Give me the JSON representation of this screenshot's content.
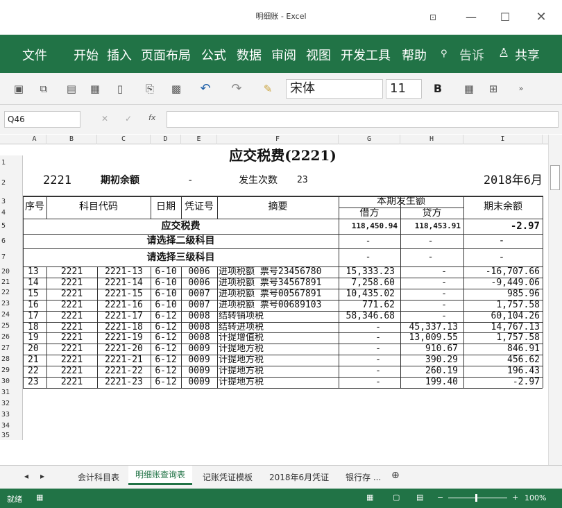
{
  "window": {
    "title": "明细账 - Excel",
    "ribbon_display_icon": "ribbon-display-icon",
    "minimize": "minimize-icon",
    "maximize": "maximize-icon",
    "close": "close-icon"
  },
  "ribbon": {
    "tabs": [
      "文件",
      "开始",
      "插入",
      "页面布局",
      "公式",
      "数据",
      "审阅",
      "视图",
      "开发工具",
      "帮助"
    ],
    "tell_me": "告诉",
    "share": "共享",
    "accent": "#217346"
  },
  "toolbar": {
    "font_name": "宋体",
    "font_size": "11",
    "bold": "B"
  },
  "formula_bar": {
    "name_box": "Q46",
    "fx": "fx",
    "value": ""
  },
  "columns": [
    "A",
    "B",
    "C",
    "D",
    "E",
    "F",
    "G",
    "H",
    "I"
  ],
  "sheet": {
    "title": "应交税费(2221)",
    "account_code": "2221",
    "opening_label": "期初余额",
    "opening_value": "-",
    "count_label": "发生次数",
    "count_value": "23",
    "period": "2018年6月",
    "headers": {
      "seq": "序号",
      "code": "科目代码",
      "date": "日期",
      "voucher": "凭证号",
      "summary": "摘要",
      "period_amount": "本期发生额",
      "debit": "借方",
      "credit": "贷方",
      "balance": "期末余额"
    },
    "total_row": {
      "label": "应交税费",
      "debit": "118,450.94",
      "credit": "118,453.91",
      "balance": "-2.97"
    },
    "level2_row": {
      "label": "请选择二级科目",
      "debit": "-",
      "credit": "-",
      "balance": "-"
    },
    "level3_row": {
      "label": "请选择三级科目",
      "debit": "-",
      "credit": "-",
      "balance": "-"
    },
    "row_numbers": [
      "1",
      "2",
      "3",
      "4",
      "5",
      "6",
      "7",
      "20",
      "21",
      "22",
      "23",
      "24",
      "25",
      "26",
      "27",
      "28",
      "29",
      "30",
      "31",
      "32",
      "33",
      "34",
      "35"
    ],
    "rows": [
      {
        "seq": "13",
        "code": "2221",
        "sub": "2221-13",
        "date": "6-10",
        "voucher": "0006",
        "summary": "进项税额 票号23456780",
        "debit": "15,333.23",
        "credit": "-",
        "balance": "-16,707.66"
      },
      {
        "seq": "14",
        "code": "2221",
        "sub": "2221-14",
        "date": "6-10",
        "voucher": "0006",
        "summary": "进项税额 票号34567891",
        "debit": "7,258.60",
        "credit": "-",
        "balance": "-9,449.06"
      },
      {
        "seq": "15",
        "code": "2221",
        "sub": "2221-15",
        "date": "6-10",
        "voucher": "0007",
        "summary": "进项税额 票号00567891",
        "debit": "10,435.02",
        "credit": "-",
        "balance": "985.96"
      },
      {
        "seq": "16",
        "code": "2221",
        "sub": "2221-16",
        "date": "6-10",
        "voucher": "0007",
        "summary": "进项税额 票号00689103",
        "debit": "771.62",
        "credit": "-",
        "balance": "1,757.58"
      },
      {
        "seq": "17",
        "code": "2221",
        "sub": "2221-17",
        "date": "6-12",
        "voucher": "0008",
        "summary": "结转销项税",
        "debit": "58,346.68",
        "credit": "-",
        "balance": "60,104.26"
      },
      {
        "seq": "18",
        "code": "2221",
        "sub": "2221-18",
        "date": "6-12",
        "voucher": "0008",
        "summary": "结转进项税",
        "debit": "-",
        "credit": "45,337.13",
        "balance": "14,767.13"
      },
      {
        "seq": "19",
        "code": "2221",
        "sub": "2221-19",
        "date": "6-12",
        "voucher": "0008",
        "summary": "计提增值税",
        "debit": "-",
        "credit": "13,009.55",
        "balance": "1,757.58"
      },
      {
        "seq": "20",
        "code": "2221",
        "sub": "2221-20",
        "date": "6-12",
        "voucher": "0009",
        "summary": "计提地方税",
        "debit": "-",
        "credit": "910.67",
        "balance": "846.91"
      },
      {
        "seq": "21",
        "code": "2221",
        "sub": "2221-21",
        "date": "6-12",
        "voucher": "0009",
        "summary": "计提地方税",
        "debit": "-",
        "credit": "390.29",
        "balance": "456.62"
      },
      {
        "seq": "22",
        "code": "2221",
        "sub": "2221-22",
        "date": "6-12",
        "voucher": "0009",
        "summary": "计提地方税",
        "debit": "-",
        "credit": "260.19",
        "balance": "196.43"
      },
      {
        "seq": "23",
        "code": "2221",
        "sub": "2221-23",
        "date": "6-12",
        "voucher": "0009",
        "summary": "计提地方税",
        "debit": "-",
        "credit": "199.40",
        "balance": "-2.97"
      }
    ]
  },
  "sheet_tabs": [
    "会计科目表",
    "明细账查询表",
    "记账凭证模板",
    "2018年6月凭证",
    "银行存 ..."
  ],
  "active_sheet": "明细账查询表",
  "status": {
    "ready": "就绪",
    "zoom": "100%"
  }
}
